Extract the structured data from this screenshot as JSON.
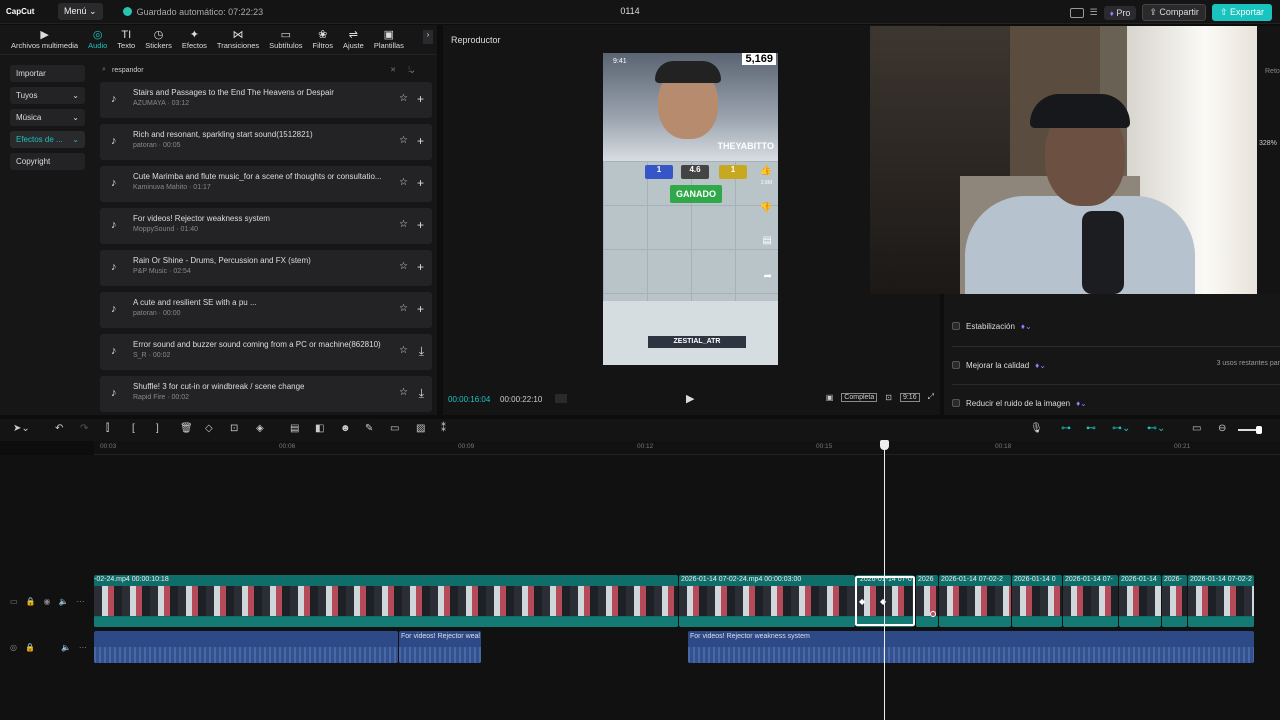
{
  "app": {
    "logo": "CapCut",
    "menu_label": "Menú ⌄",
    "autosave": "Guardado automático: 07:22:23",
    "project_title": "0114",
    "pro_label": "Pro",
    "share_label": "Compartir",
    "export_label": "Exportar"
  },
  "tabs": [
    {
      "icon": "▶",
      "label": "Archivos multimedia"
    },
    {
      "icon": "◎",
      "label": "Audio"
    },
    {
      "icon": "TI",
      "label": "Texto"
    },
    {
      "icon": "◷",
      "label": "Stickers"
    },
    {
      "icon": "✦",
      "label": "Efectos"
    },
    {
      "icon": "⋈",
      "label": "Transiciones"
    },
    {
      "icon": "▭",
      "label": "Subtítulos"
    },
    {
      "icon": "❀",
      "label": "Filtros"
    },
    {
      "icon": "⇌",
      "label": "Ajuste"
    },
    {
      "icon": "▣",
      "label": "Plantillas"
    }
  ],
  "side_nav": [
    {
      "label": "Importar",
      "arrow": ""
    },
    {
      "label": "Tuyos",
      "arrow": "⌄"
    },
    {
      "label": "Música",
      "arrow": "⌄"
    },
    {
      "label": "Efectos de ...",
      "arrow": "⌄"
    },
    {
      "label": "Copyright",
      "arrow": ""
    }
  ],
  "search": {
    "value": "respandor"
  },
  "sounds": [
    {
      "name": "Stairs and Passages to the End The Heavens or Despair",
      "meta": "AZUMAYA · 03:12",
      "action": "+"
    },
    {
      "name": "Rich and resonant, sparkling start sound(1512821)",
      "meta": "patoran · 00:05",
      "action": "+"
    },
    {
      "name": "Cute Marimba and flute music_for a scene of thoughts or consultatio...",
      "meta": "Kaminuva Mahito · 01:17",
      "action": "+"
    },
    {
      "name": "For videos! Rejector weakness system",
      "meta": "MoppySound · 01:40",
      "action": "+"
    },
    {
      "name": "Rain Or Shine - Drums, Percussion and FX (stem)",
      "meta": "P&P Music · 02:54",
      "action": "+"
    },
    {
      "name": "A cute and resilient SE with a pu ...",
      "meta": "patoran · 00:00",
      "action": "+"
    },
    {
      "name": "Error sound and buzzer sound coming from a PC or machine(862810)",
      "meta": "S_R · 00:02",
      "action": "⤓"
    },
    {
      "name": "Shuffle! 3 for cut-in or windbreak / scene change",
      "meta": "Rapid Fire · 00:02",
      "action": "⤓"
    }
  ],
  "player": {
    "title": "Reproductor",
    "current_time": "00:00:16:04",
    "total_time": "00:00:22:10",
    "view_label": "Completa",
    "ratio_label": "9:16",
    "video": {
      "count": "5,169",
      "clock": "9:41",
      "username": "THEYABITTO",
      "score_left": "1",
      "score_mid": "4.6",
      "score_right": "1",
      "result": "GANADO",
      "bottom_name": "ZESTIAL_ATR",
      "likes": "2.8M"
    }
  },
  "properties": {
    "items": [
      {
        "label": "Estabilización"
      },
      {
        "label": "Mejorar la calidad"
      },
      {
        "label": "Reducir el ruido de la imagen"
      }
    ],
    "uses_left": "3 usos restantes par",
    "edge_top": "Reto",
    "edge_percent": "328%"
  },
  "timeline": {
    "ticks": [
      "00:03",
      "00:06",
      "00:09",
      "00:12",
      "00:15",
      "00:18",
      "00:21"
    ],
    "clips": [
      {
        "label": "-02-24.mp4  00:00:10:18"
      },
      {
        "label": "2026-01-14 07-02-24.mp4  00:00:03:00"
      },
      {
        "label": "2026-01-14 07-0"
      },
      {
        "label": "2026"
      },
      {
        "label": "2026-01-14 07-02-2"
      },
      {
        "label": "2026-01-14 0"
      },
      {
        "label": "2026-01-14 07-"
      },
      {
        "label": "2026-01-14"
      },
      {
        "label": "2026-"
      },
      {
        "label": "2026-01-14 07-02-2"
      }
    ],
    "audio": [
      {
        "label": "For videos! Rejector weal"
      },
      {
        "label": "For videos! Rejector weakness system"
      }
    ]
  },
  "colors": {
    "accent": "#19c3c0",
    "video_track": "#0f6e6a",
    "audio_track": "#2d4a86"
  }
}
